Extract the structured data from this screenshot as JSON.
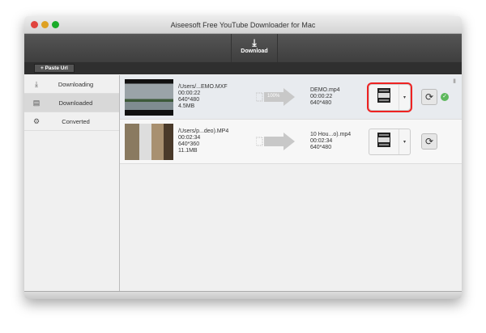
{
  "window": {
    "title": "Aiseesoft Free YouTube Downloader for Mac"
  },
  "toolbar": {
    "download_label": "Download",
    "paste_label": "+ Paste Url"
  },
  "sidebar": {
    "items": [
      {
        "label": "Downloading",
        "icon": "download-icon"
      },
      {
        "label": "Downloaded",
        "icon": "downloaded-icon",
        "active": true
      },
      {
        "label": "Converted",
        "icon": "converted-icon"
      }
    ]
  },
  "rows": [
    {
      "src_path": "/Users/...EMO.MXF",
      "src_duration": "00:00:22",
      "src_res": "640*480",
      "src_size": "4.5MB",
      "progress": "100%",
      "out_name": "DEMO.mp4",
      "out_duration": "00:00:22",
      "out_res": "640*480",
      "done": true
    },
    {
      "src_path": "/Users/p...deo).MP4",
      "src_duration": "00:02:34",
      "src_res": "640*360",
      "src_size": "11.1MB",
      "progress": "",
      "out_name": "10 Hou...o).mp4",
      "out_duration": "00:02:34",
      "out_res": "640*480",
      "done": false
    }
  ],
  "icons": {
    "check": "✓",
    "refresh": "⟳",
    "dropdown": "▾",
    "trash": "🗑"
  }
}
